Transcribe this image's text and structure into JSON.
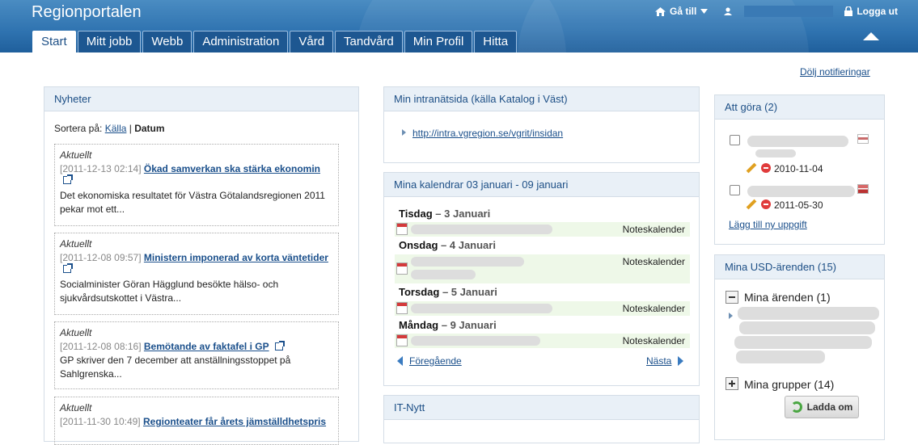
{
  "header": {
    "logo": "Regionportalen",
    "goto_label": "Gå till",
    "logout_label": "Logga ut"
  },
  "tabs": [
    "Start",
    "Mitt jobb",
    "Webb",
    "Administration",
    "Vård",
    "Tandvård",
    "Min Profil",
    "Hitta"
  ],
  "hide_notifications": "Dölj notifieringar",
  "news": {
    "title": "Nyheter",
    "sort_prefix": "Sortera på:",
    "sort_source": "Källa",
    "sort_date": "Datum",
    "items": [
      {
        "category": "Aktuellt",
        "date": "[2011-12-13  02:14]",
        "title": "Ökad samverkan ska stärka ekonomin",
        "text": "Det ekonomiska resultatet för Västra Götalandsregionen 2011 pekar mot ett..."
      },
      {
        "category": "Aktuellt",
        "date": "[2011-12-08  09:57]",
        "title": "Ministern imponerad av korta väntetider",
        "text": "Socialminister Göran Hägglund besökte hälso- och sjukvårdsutskottet i Västra..."
      },
      {
        "category": "Aktuellt",
        "date": "[2011-12-08  08:16]",
        "title": "Bemötande av faktafel i GP",
        "text": "GP skriver den 7 december att anställningsstoppet på Sahlgrenska..."
      },
      {
        "category": "Aktuellt",
        "date": "[2011-11-30  10:49]",
        "title": "Regionteater får årets jämställdhetspris",
        "text": ""
      }
    ]
  },
  "intranet": {
    "title": "Min intranätsida (källa Katalog i Väst)",
    "link": "http://intra.vgregion.se/vgrit/insidan"
  },
  "calendar": {
    "title": "Mina kalendrar 03 januari - 09 januari",
    "days": [
      {
        "weekday": "Tisdag",
        "date": "3 Januari",
        "source": "Noteskalender"
      },
      {
        "weekday": "Onsdag",
        "date": "4 Januari",
        "source": "Noteskalender"
      },
      {
        "weekday": "Torsdag",
        "date": "5 Januari",
        "source": "Noteskalender"
      },
      {
        "weekday": "Måndag",
        "date": "9 Januari",
        "source": "Noteskalender"
      }
    ],
    "prev": "Föregående",
    "next": "Nästa"
  },
  "itnytt": {
    "title": "IT-Nytt"
  },
  "todo": {
    "title": "Att göra (2)",
    "items": [
      {
        "date": "2010-11-04"
      },
      {
        "date": "2011-05-30"
      }
    ],
    "add_link": "Lägg till ny uppgift"
  },
  "usd": {
    "title": "Mina USD-ärenden (15)",
    "my_cases": "Mina ärenden (1)",
    "my_groups": "Mina grupper (14)",
    "reload": "Ladda om"
  }
}
